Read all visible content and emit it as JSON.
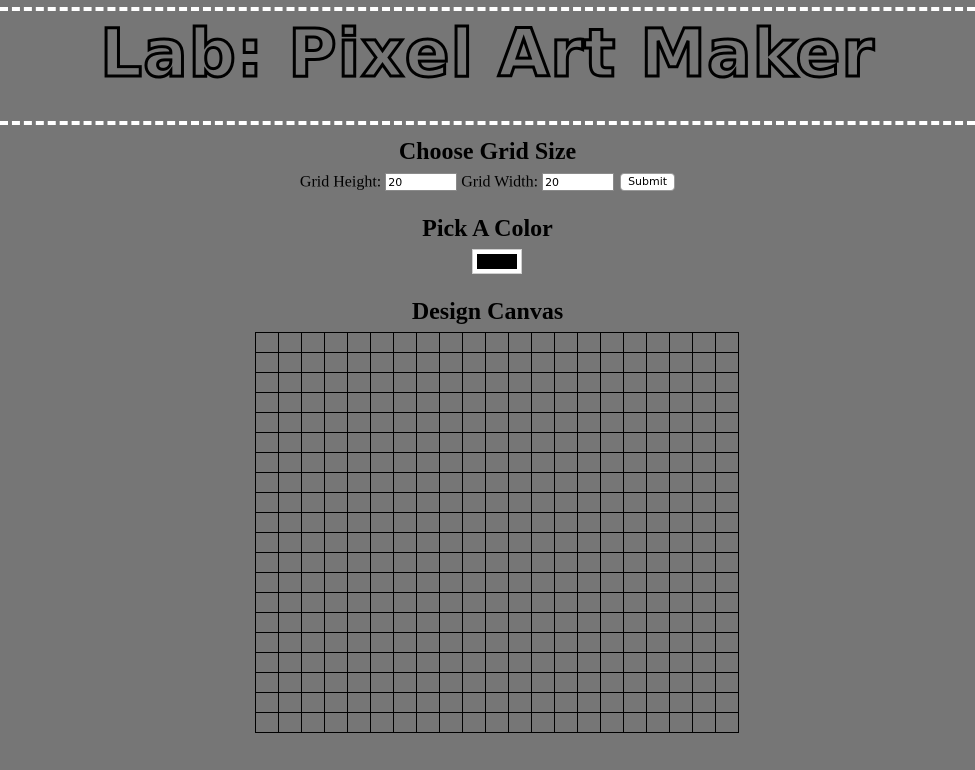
{
  "page": {
    "title": "Lab: Pixel Art Maker",
    "background_color": "#767676",
    "header_border_color": "#ffffff"
  },
  "grid_size": {
    "heading": "Choose Grid Size",
    "height_label": "Grid Height:",
    "height_value": "20",
    "width_label": "Grid Width:",
    "width_value": "20",
    "submit_label": "Submit"
  },
  "color_picker": {
    "heading": "Pick A Color",
    "selected_color": "#000000"
  },
  "canvas": {
    "heading": "Design Canvas",
    "rows": 20,
    "columns": 21,
    "grid_line_color": "#000000"
  }
}
